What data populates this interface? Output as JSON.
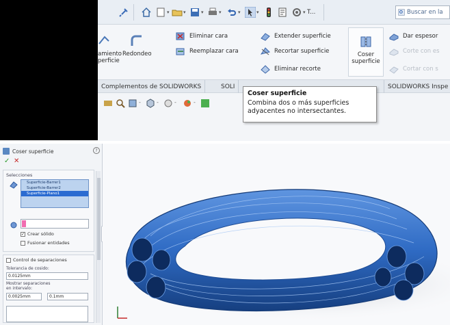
{
  "quick_access": {
    "search_placeholder": "Buscar en la",
    "customize_label": "T..."
  },
  "ribbon": {
    "left_cut_label_1": "amiento",
    "left_cut_label_2": "perficie",
    "redondeo_label": "Redondeo",
    "eliminar_cara": "Eliminar cara",
    "reemplazar_cara": "Reemplazar cara",
    "extender_superficie": "Extender superficie",
    "recortar_superficie": "Recortar superficie",
    "eliminar_recorte": "Eliminar recorte",
    "coser_superficie_1": "Coser",
    "coser_superficie_2": "superficie",
    "dar_espesor": "Dar espesor",
    "cortar_con_es": "Corte con es",
    "cortar_con_s": "Cortar con s"
  },
  "tabs": [
    "Complementos de SOLIDWORKS",
    "SOLI",
    "SOLIDWORKS Inspe"
  ],
  "tooltip": {
    "title": "Coser superficie",
    "body_line1": "Combina dos o más superficies",
    "body_line2": "adyacentes no intersectantes."
  },
  "property_manager": {
    "title": "Coser superficie",
    "help": "?",
    "ok": "✓",
    "cancel": "✕",
    "selections_title": "Selecciones",
    "items": [
      "Superficie-Barrer1",
      "Superficie-Barrer2",
      "Superficie-Plano1"
    ],
    "crear_solido": "Crear sólido",
    "fusionar_entidades": "Fusionar entidades",
    "control_separaciones": "Control de separaciones",
    "tolerancia_label": "Tolerancia de cosido:",
    "tolerancia_value": "0.0125mm",
    "mostrar_separaciones": "Mostrar separaciones",
    "en_intervalo": "en intervalo:",
    "range_min": "0.0025mm",
    "range_max": "0.1mm"
  },
  "colors": {
    "accent": "#2a6bd1",
    "model_blue": "#2f6bc4",
    "tooltip_border": "#8b8b8b"
  }
}
